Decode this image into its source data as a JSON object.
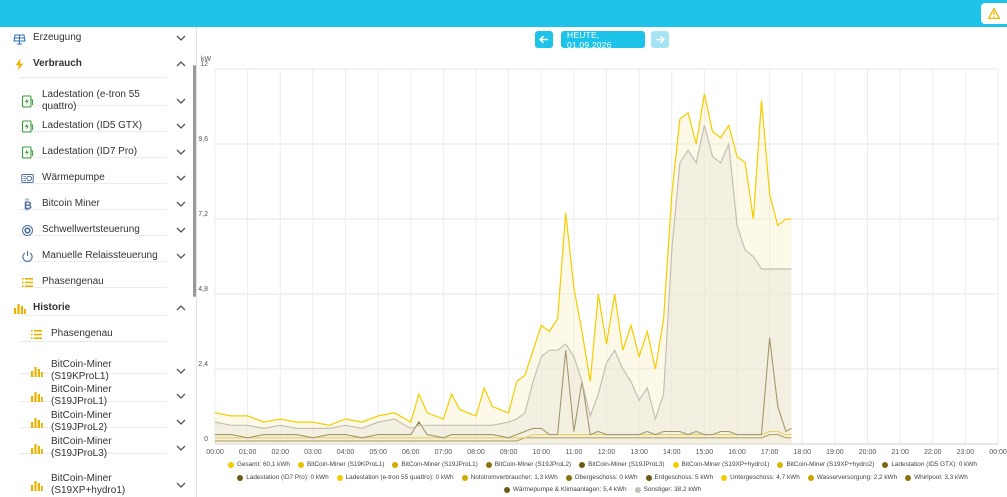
{
  "sidebar": {
    "items": [
      {
        "label": "Erzeugung",
        "icon": "solar-panel-icon",
        "level": "group"
      },
      {
        "label": "Verbrauch",
        "icon": "lightning-icon",
        "level": "group"
      },
      {
        "label": "Ladestation (e-tron 55 quattro)",
        "icon": "charging-station-icon"
      },
      {
        "label": "Ladestation (ID5 GTX)",
        "icon": "charging-station-icon"
      },
      {
        "label": "Ladestation (ID7 Pro)",
        "icon": "charging-station-icon"
      },
      {
        "label": "Wärmepumpe",
        "icon": "heat-pump-icon"
      },
      {
        "label": "Bitcoin Miner",
        "icon": "bitcoin-icon"
      },
      {
        "label": "Schwellwertsteuerung",
        "icon": "threshold-icon"
      },
      {
        "label": "Manuelle Relaissteuerung",
        "icon": "power-icon"
      },
      {
        "label": "Phasengenau",
        "icon": "list-icon"
      },
      {
        "label": "Historie",
        "icon": "bar-chart-icon",
        "level": "group"
      },
      {
        "label": "Phasengenau",
        "icon": "list-icon"
      },
      {
        "label": "BitCoin-Miner (S19KProL1)",
        "icon": "bar-chart-icon"
      },
      {
        "label": "BitCoin-Miner (S19JProL1)",
        "icon": "bar-chart-icon"
      },
      {
        "label": "BitCoin-Miner (S19JProL2)",
        "icon": "bar-chart-icon"
      },
      {
        "label": "BitCoin-Miner (S19JProL3)",
        "icon": "bar-chart-icon"
      },
      {
        "label": "BitCoin-Miner (S19XP+hydro1)",
        "icon": "bar-chart-icon"
      }
    ]
  },
  "datenav": {
    "label": "HEUTE, 01.09.2026"
  },
  "colors": {
    "accent": "#1ec3ea",
    "yellow": "#f2cd00",
    "gold": "#c9a400",
    "brown": "#6b5a16",
    "grey": "#c3bfb5",
    "olive": "#8a7310"
  },
  "chart_data": {
    "type": "line",
    "ylabel": "kW",
    "ylim": [
      0,
      12
    ],
    "yticks": [
      "0",
      "2,4",
      "4,8",
      "7,2",
      "9,6",
      "12"
    ],
    "xticks": [
      "00:00",
      "01:00",
      "02:00",
      "03:00",
      "04:00",
      "05:00",
      "06:00",
      "07:00",
      "08:00",
      "09:00",
      "10:00",
      "11:00",
      "12:00",
      "13:00",
      "14:00",
      "15:00",
      "16:00",
      "17:00",
      "18:00",
      "19:00",
      "20:00",
      "21:00",
      "22:00",
      "23:00",
      "00:00"
    ],
    "x_hours": [
      0,
      0.5,
      1,
      1.5,
      2,
      2.5,
      3,
      3.5,
      4,
      4.5,
      5,
      5.5,
      6,
      6.25,
      6.5,
      7,
      7.25,
      7.5,
      8,
      8.25,
      8.5,
      9,
      9.25,
      9.5,
      9.75,
      10,
      10.25,
      10.5,
      10.75,
      11,
      11.25,
      11.5,
      11.75,
      12,
      12.25,
      12.5,
      12.75,
      13,
      13.25,
      13.5,
      13.75,
      14,
      14.25,
      14.5,
      14.75,
      15,
      15.25,
      15.5,
      15.75,
      16,
      16.25,
      16.5,
      16.75,
      17,
      17.25,
      17.5,
      17.67
    ],
    "series": [
      {
        "name": "Gesamt: 60,1 kWh",
        "color": "#f2cd00",
        "style": "line",
        "values": [
          1.0,
          0.9,
          0.9,
          0.7,
          0.8,
          0.7,
          0.7,
          0.6,
          0.8,
          0.7,
          0.9,
          1.0,
          0.7,
          1.6,
          1.0,
          0.8,
          1.6,
          1.1,
          0.9,
          1.8,
          1.2,
          1.0,
          2.0,
          2.2,
          3.0,
          3.8,
          3.6,
          4.0,
          7.4,
          5.0,
          3.6,
          2.0,
          4.8,
          3.2,
          4.8,
          3.0,
          3.8,
          2.8,
          3.6,
          2.4,
          4.0,
          8.0,
          10.4,
          10.6,
          9.6,
          11.2,
          10.0,
          9.8,
          10.2,
          9.2,
          9.0,
          7.2,
          11.0,
          8.0,
          7.0,
          7.2,
          7.2
        ]
      },
      {
        "name": "Sonstiger: 38,2 kWh",
        "color": "#c3bfb5",
        "style": "area",
        "values": [
          0.7,
          0.6,
          0.6,
          0.5,
          0.6,
          0.5,
          0.5,
          0.5,
          0.6,
          0.5,
          0.7,
          0.8,
          0.5,
          0.6,
          0.6,
          0.6,
          0.6,
          0.6,
          0.6,
          0.6,
          0.6,
          0.7,
          0.8,
          1.0,
          2.0,
          2.8,
          3.0,
          3.0,
          3.2,
          2.8,
          2.0,
          0.9,
          1.6,
          2.6,
          3.0,
          2.4,
          2.0,
          1.4,
          1.8,
          0.8,
          1.6,
          6.2,
          9.0,
          9.4,
          9.0,
          10.2,
          9.2,
          9.0,
          9.6,
          7.0,
          6.2,
          6.0,
          5.6,
          5.6,
          5.6,
          5.6,
          5.6
        ]
      },
      {
        "name": "Wärmepumpe & Klimaanlagen: 5,4 kWh",
        "color": "#6b5a16",
        "style": "line",
        "values": [
          0.3,
          0.3,
          0.2,
          0.3,
          0.3,
          0.3,
          0.2,
          0.3,
          0.3,
          0.2,
          0.3,
          0.3,
          0.3,
          0.7,
          0.3,
          0.2,
          0.3,
          0.3,
          0.3,
          0.3,
          0.3,
          0.2,
          0.3,
          0.4,
          0.5,
          0.5,
          0.3,
          0.3,
          3.0,
          0.4,
          2.0,
          0.3,
          0.4,
          0.3,
          0.3,
          0.3,
          0.3,
          0.3,
          0.4,
          0.3,
          0.4,
          0.4,
          0.4,
          0.3,
          0.4,
          0.3,
          0.3,
          0.4,
          0.4,
          0.3,
          0.3,
          0.3,
          0.3,
          3.4,
          1.2,
          0.4,
          0.5
        ]
      },
      {
        "name": "Untergeschoss: 4,7 kWh",
        "color": "#e5c300",
        "style": "line",
        "values": [
          0.2,
          0.2,
          0.2,
          0.2,
          0.2,
          0.2,
          0.2,
          0.2,
          0.2,
          0.2,
          0.2,
          0.2,
          0.2,
          0.2,
          0.2,
          0.2,
          0.2,
          0.2,
          0.2,
          0.2,
          0.2,
          0.2,
          0.2,
          0.2,
          0.3,
          0.3,
          0.3,
          0.3,
          0.3,
          0.3,
          0.3,
          0.3,
          0.3,
          0.3,
          0.3,
          0.3,
          0.3,
          0.3,
          0.3,
          0.3,
          0.3,
          0.3,
          0.3,
          0.3,
          0.3,
          0.3,
          0.3,
          0.3,
          0.3,
          0.3,
          0.3,
          0.3,
          0.3,
          0.4,
          0.4,
          0.3,
          0.3
        ]
      },
      {
        "name": "Erdgeschoss: 5 kWh",
        "color": "#8a7310",
        "style": "line",
        "values": [
          0.1,
          0.1,
          0.1,
          0.1,
          0.1,
          0.1,
          0.1,
          0.1,
          0.1,
          0.1,
          0.1,
          0.1,
          0.1,
          0.1,
          0.1,
          0.1,
          0.1,
          0.1,
          0.1,
          0.1,
          0.1,
          0.1,
          0.1,
          0.2,
          0.2,
          0.2,
          0.2,
          0.2,
          0.2,
          0.2,
          0.2,
          0.2,
          0.2,
          0.2,
          0.2,
          0.2,
          0.2,
          0.2,
          0.2,
          0.2,
          0.2,
          0.2,
          0.2,
          0.2,
          0.2,
          0.2,
          0.2,
          0.2,
          0.2,
          0.2,
          0.2,
          0.2,
          0.2,
          0.3,
          0.3,
          0.2,
          0.2
        ]
      }
    ],
    "legend": [
      {
        "label": "Gesamt: 60,1 kWh",
        "color": "#f2cd00"
      },
      {
        "label": "BitCoin-Miner (S19KProL1)",
        "color": "#e8c200"
      },
      {
        "label": "BitCoin-Miner (S19JProL1)",
        "color": "#d1a900"
      },
      {
        "label": "BitCoin-Miner (S19JProL2)",
        "color": "#8a7310"
      },
      {
        "label": "BitCoin-Miner (S19JProL3)",
        "color": "#6b5a16"
      },
      {
        "label": "BitCoin-Miner (S19XP+hydro1)",
        "color": "#f2cd00"
      },
      {
        "label": "BitCoin-Miner (S19XP+hydro2)",
        "color": "#d9b600"
      },
      {
        "label": "Ladestation (ID5 GTX): 0 kWh",
        "color": "#7a6411"
      },
      {
        "label": "Ladestation (ID7 Pro): 0 kWh",
        "color": "#6b5a16"
      },
      {
        "label": "Ladestation (e-tron 55 quattro): 0 kWh",
        "color": "#f2cd00"
      },
      {
        "label": "Notstromverbraucher: 1,3 kWh",
        "color": "#d1a900"
      },
      {
        "label": "Obergeschoss: 0 kWh",
        "color": "#8a7310"
      },
      {
        "label": "Erdgeschoss: 5 kWh",
        "color": "#6b5a16"
      },
      {
        "label": "Untergeschoss: 4,7 kWh",
        "color": "#f2cd00"
      },
      {
        "label": "Wasserversorgung: 2,2 kWh",
        "color": "#c9a400"
      },
      {
        "label": "Whirlpool: 3,3 kWh",
        "color": "#8a7310"
      },
      {
        "label": "Wärmepumpe & Klimaanlagen: 5,4 kWh",
        "color": "#6b5a16"
      },
      {
        "label": "Sonstiger: 38,2 kWh",
        "color": "#c3bfb5"
      }
    ]
  }
}
